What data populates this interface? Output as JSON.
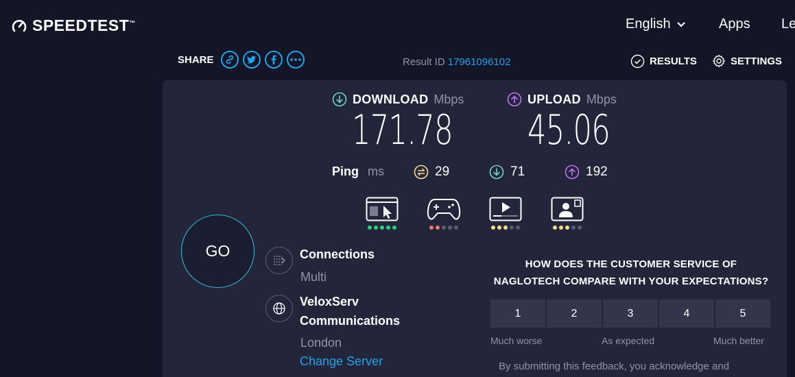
{
  "header": {
    "logo_text": "SPEEDTEST",
    "logo_mark": "™",
    "nav": {
      "language": "English",
      "apps": "Apps",
      "learn": "Le"
    }
  },
  "sharebar": {
    "share_label": "SHARE",
    "icons": [
      "link-icon",
      "twitter-icon",
      "facebook-icon",
      "more-icon"
    ],
    "result_id_label": "Result ID",
    "result_id": "17961096102",
    "results_label": "RESULTS",
    "settings_label": "SETTINGS"
  },
  "metrics": {
    "download": {
      "label": "DOWNLOAD",
      "unit": "Mbps",
      "value": "171.78",
      "color": "#6ed7d3"
    },
    "upload": {
      "label": "UPLOAD",
      "unit": "Mbps",
      "value": "45.06",
      "color": "#bf71f2"
    }
  },
  "ping": {
    "label": "Ping",
    "unit": "ms",
    "idle": "29",
    "download": "71",
    "upload": "192",
    "idle_color": "#fddd8c"
  },
  "quality": [
    {
      "icon": "web-browsing-icon",
      "rating": 5,
      "dot_color": "#26d07c"
    },
    {
      "icon": "gaming-icon",
      "rating": 2,
      "dot_color": "#f27a6b"
    },
    {
      "icon": "video-streaming-icon",
      "rating": 3,
      "dot_color": "#fddd8c"
    },
    {
      "icon": "video-chat-icon",
      "rating": 3,
      "dot_color": "#fddd8c"
    }
  ],
  "go_label": "GO",
  "connections": {
    "title": "Connections",
    "value": "Multi"
  },
  "server": {
    "name_line1": "VeloxServ",
    "name_line2": "Communications",
    "location": "London",
    "change_label": "Change Server"
  },
  "survey": {
    "question_line1": "HOW DOES THE CUSTOMER SERVICE OF",
    "question_line2": "NAGLOTECH COMPARE WITH YOUR EXPECTATIONS?",
    "options": [
      "1",
      "2",
      "3",
      "4",
      "5"
    ],
    "label_low": "Much worse",
    "label_mid": "As expected",
    "label_high": "Much better",
    "disclaimer": "By submitting this feedback, you acknowledge and"
  }
}
